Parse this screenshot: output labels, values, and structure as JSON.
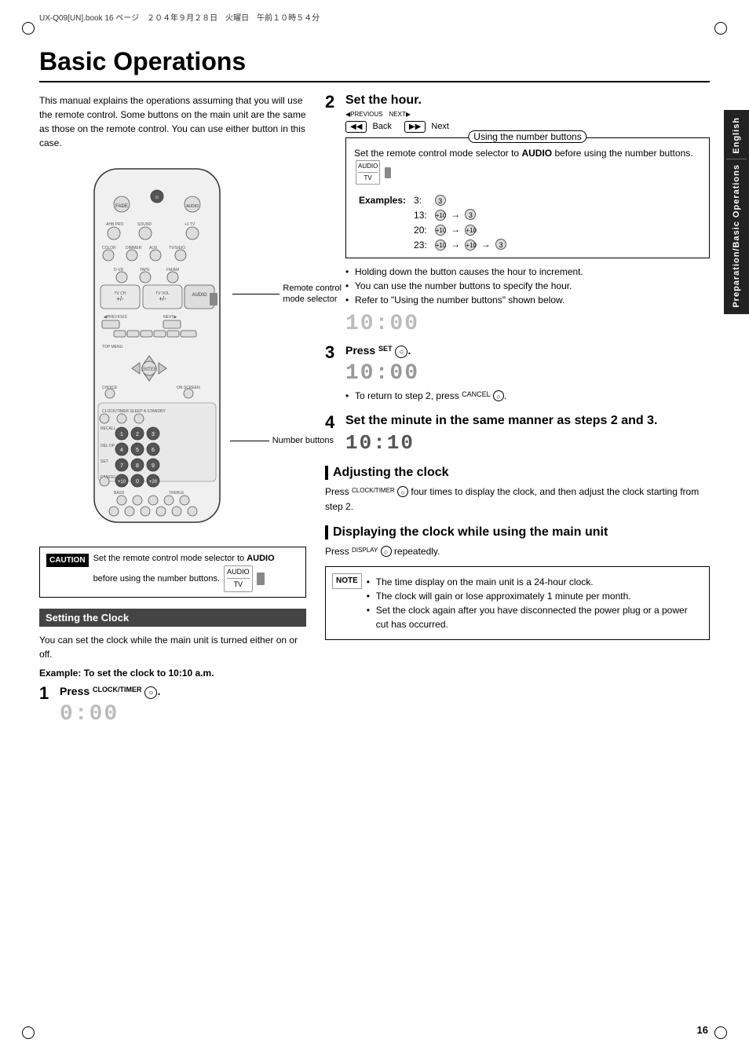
{
  "page": {
    "title": "Basic Operations",
    "number": "16",
    "top_info": "UX-Q09[UN].book  16 ページ　２０４年９月２８日　火曜日　午前１０時５４分",
    "side_tab_top": "English",
    "side_tab_bottom": "Preparation/Basic Operations"
  },
  "intro": {
    "text": "This manual explains the operations assuming that you will use the remote control. Some buttons on the main unit are the same as those on the remote control. You can use either button in this case."
  },
  "remote": {
    "label_mode_selector": "Remote control\nmode selector",
    "label_number_buttons": "Number buttons"
  },
  "caution": {
    "label": "CAUTION",
    "text": "Set the remote control mode selector to AUDIO before using the number buttons.",
    "audio_label": "AUDIO",
    "tv_label": "TV"
  },
  "setting_clock": {
    "header": "Setting the Clock",
    "intro": "You can set the clock while the main unit is turned either on or off.",
    "example_label": "Example: To set the clock to 10:10 a.m."
  },
  "steps": [
    {
      "number": "1",
      "title": "Press",
      "button_label": "CLOCK/TIMER",
      "button": "○",
      "display": "0:00",
      "display_style": "dim"
    },
    {
      "number": "2",
      "title": "Set the hour.",
      "previous_label": "PREVIOUS",
      "next_label": "NEXT",
      "back_label": "Back",
      "next_nav_label": "Next",
      "bullets": [
        "Holding down the button causes the hour to increment.",
        "You can use the number buttons to specify the hour.",
        "Refer to \"Using the number buttons\" shown below."
      ],
      "display": "10:00",
      "display_style": "dim"
    },
    {
      "number": "3",
      "title": "Press",
      "button_label": "SET",
      "button": "○",
      "display_before": "10:00",
      "display_after": "10:00",
      "bullet": "To return to step 2, press",
      "cancel_label": "CANCEL"
    },
    {
      "number": "4",
      "title": "Set the minute in the same manner as steps 2 and 3.",
      "display": "10:10"
    }
  ],
  "number_buttons_box": {
    "title": "Using the number buttons",
    "text": "Set the remote control mode selector to AUDIO before using the number buttons.",
    "examples_label": "Examples:",
    "examples": [
      {
        "num": "3:",
        "steps": "③"
      },
      {
        "num": "13:",
        "steps": "+10 → ③"
      },
      {
        "num": "20:",
        "steps": "+10 → +10"
      },
      {
        "num": "23:",
        "steps": "+10 → +10 → ③"
      }
    ]
  },
  "adjusting_clock": {
    "title": "Adjusting the clock",
    "text": "Press",
    "button_label": "CLOCK/TIMER",
    "text2": "four times to display the clock, and then adjust the clock starting from step 2."
  },
  "displaying_clock": {
    "title": "Displaying the clock while using the main unit",
    "text": "Press",
    "button_label": "DISPLAY",
    "text2": "repeatedly."
  },
  "note": {
    "label": "NOTE",
    "bullets": [
      "The time display on the main unit is a 24-hour clock.",
      "The clock will gain or lose approximately 1 minute per month.",
      "Set the clock again after you have disconnected the power plug or a power cut has occurred."
    ]
  }
}
